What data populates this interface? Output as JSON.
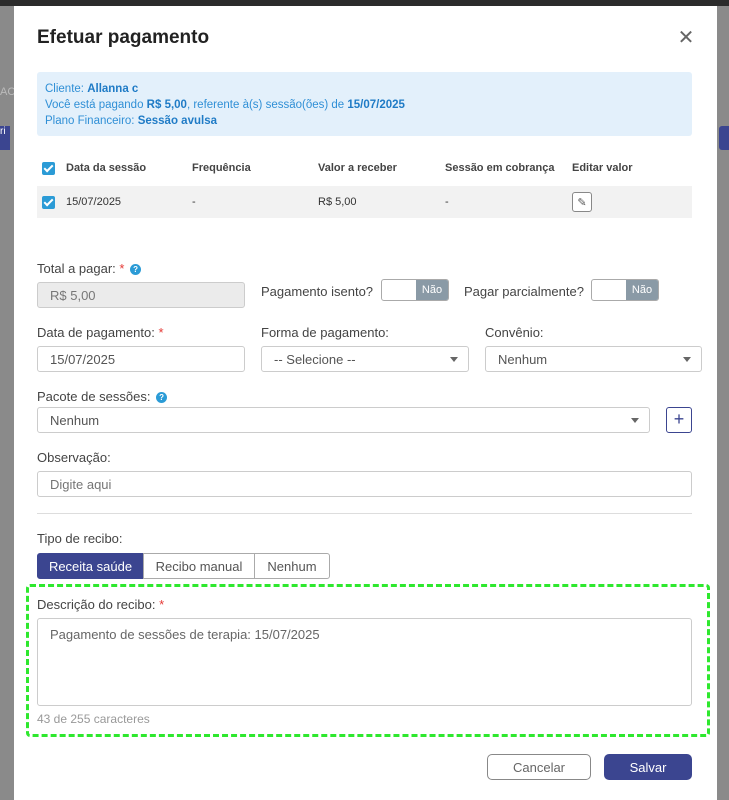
{
  "backdrop": {
    "left_text": "AC",
    "left_tab": "ri"
  },
  "modal": {
    "title": "Efetuar pagamento"
  },
  "info": {
    "client_label": "Cliente: ",
    "client_name": "Allanna c",
    "paying_prefix": "Você está pagando ",
    "paying_amount": "R$ 5,00",
    "paying_middle": ", referente à(s) sessão(ões) de ",
    "paying_date": "15/07/2025",
    "plan_label": "Plano Financeiro: ",
    "plan_name": "Sessão avulsa"
  },
  "table": {
    "headers": {
      "date": "Data da sessão",
      "frequency": "Frequência",
      "value": "Valor a receber",
      "billing": "Sessão em cobrança",
      "edit": "Editar valor"
    },
    "rows": [
      {
        "date": "15/07/2025",
        "frequency": "-",
        "value": "R$ 5,00",
        "billing": "-"
      }
    ]
  },
  "form": {
    "total_label": "Total a pagar:",
    "total_value": "R$ 5,00",
    "exempt_label": "Pagamento isento?",
    "exempt_value": "Não",
    "partial_label": "Pagar parcialmente?",
    "partial_value": "Não",
    "payment_date_label": "Data de pagamento:",
    "payment_date_value": "15/07/2025",
    "payment_method_label": "Forma de pagamento:",
    "payment_method_value": "-- Selecione --",
    "agreement_label": "Convênio:",
    "agreement_value": "Nenhum",
    "package_label": "Pacote de sessões:",
    "package_value": "Nenhum",
    "notes_label": "Observação:",
    "notes_placeholder": "Digite aqui",
    "receipt_type_label": "Tipo de recibo:",
    "receipt_types": [
      "Receita saúde",
      "Recibo manual",
      "Nenhum"
    ],
    "receipt_desc_label": "Descrição do recibo:",
    "receipt_desc_value": "Pagamento de sessões de terapia: 15/07/2025",
    "char_count": "43 de 255 caracteres",
    "required_mark": "*",
    "help_mark": "?",
    "plus_mark": "+"
  },
  "footer": {
    "cancel": "Cancelar",
    "save": "Salvar"
  },
  "colors": {
    "primary": "#3b4590",
    "info_text": "#2f8fd6",
    "highlight": "#2ee82e",
    "required": "#e53935"
  }
}
